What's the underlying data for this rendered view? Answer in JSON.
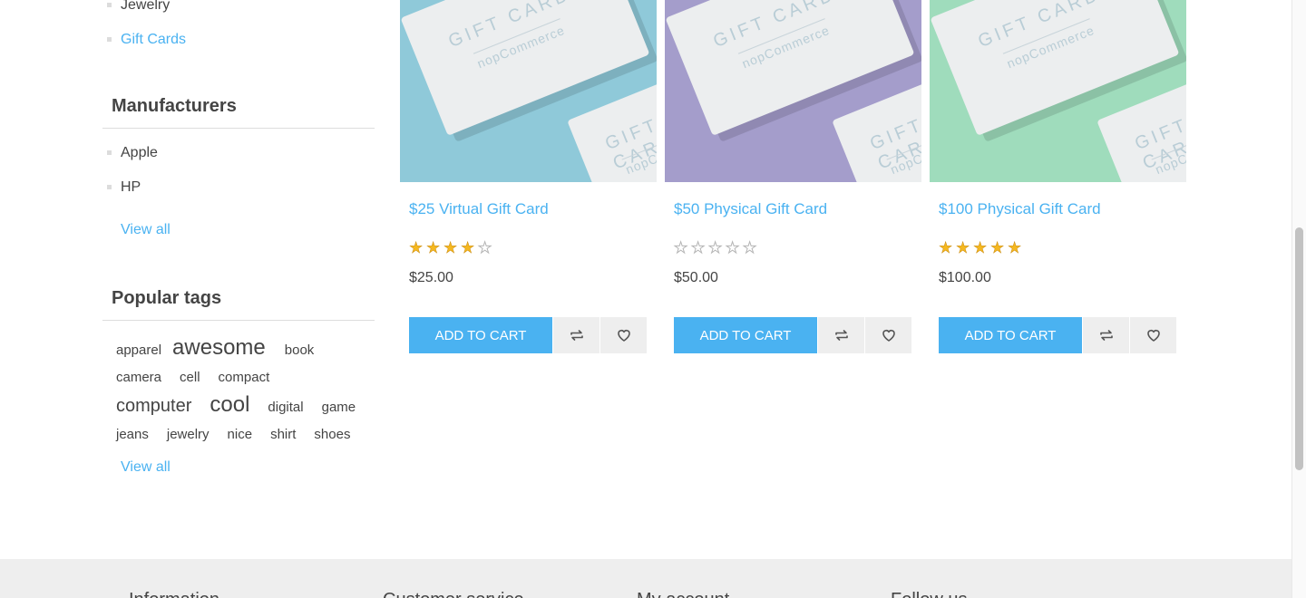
{
  "sidebar": {
    "categories": [
      {
        "label": "Jewelry"
      },
      {
        "label": "Gift Cards"
      }
    ],
    "manufacturers": {
      "title": "Manufacturers",
      "items": [
        {
          "label": "Apple"
        },
        {
          "label": "HP"
        }
      ],
      "view_all": "View all"
    },
    "popular_tags": {
      "title": "Popular tags",
      "tags": [
        "apparel",
        "awesome",
        "book",
        "camera",
        "cell",
        "compact",
        "computer",
        "cool",
        "digital",
        "game",
        "jeans",
        "jewelry",
        "nice",
        "shirt",
        "shoes"
      ],
      "view_all": "View all"
    }
  },
  "products": [
    {
      "title": "$25 Virtual Gift Card",
      "price": "$25.00",
      "rating": 4,
      "image_color": "#8fc9d9",
      "card_text": "GIFT CARD",
      "card_sub": "nopCommerce",
      "add_to_cart": "ADD TO CART",
      "compare_icon": "compare-icon",
      "wishlist_icon": "heart-icon"
    },
    {
      "title": "$50 Physical Gift Card",
      "price": "$50.00",
      "rating": 0,
      "image_color": "#a49dcb",
      "card_text": "GIFT CARD",
      "card_sub": "nopCommerce",
      "add_to_cart": "ADD TO CART",
      "compare_icon": "compare-icon",
      "wishlist_icon": "heart-icon"
    },
    {
      "title": "$100 Physical Gift Card",
      "price": "$100.00",
      "rating": 5,
      "image_color": "#9fdcbc",
      "card_text": "GIFT CARD",
      "card_sub": "nopCommerce",
      "add_to_cart": "ADD TO CART",
      "compare_icon": "compare-icon",
      "wishlist_icon": "heart-icon"
    }
  ],
  "footer": {
    "columns": [
      "Information",
      "Customer service",
      "My account",
      "Follow us"
    ]
  },
  "colors": {
    "accent": "#4ab2f1",
    "star": "#f5b820",
    "footer_bg": "#eeeeee"
  }
}
